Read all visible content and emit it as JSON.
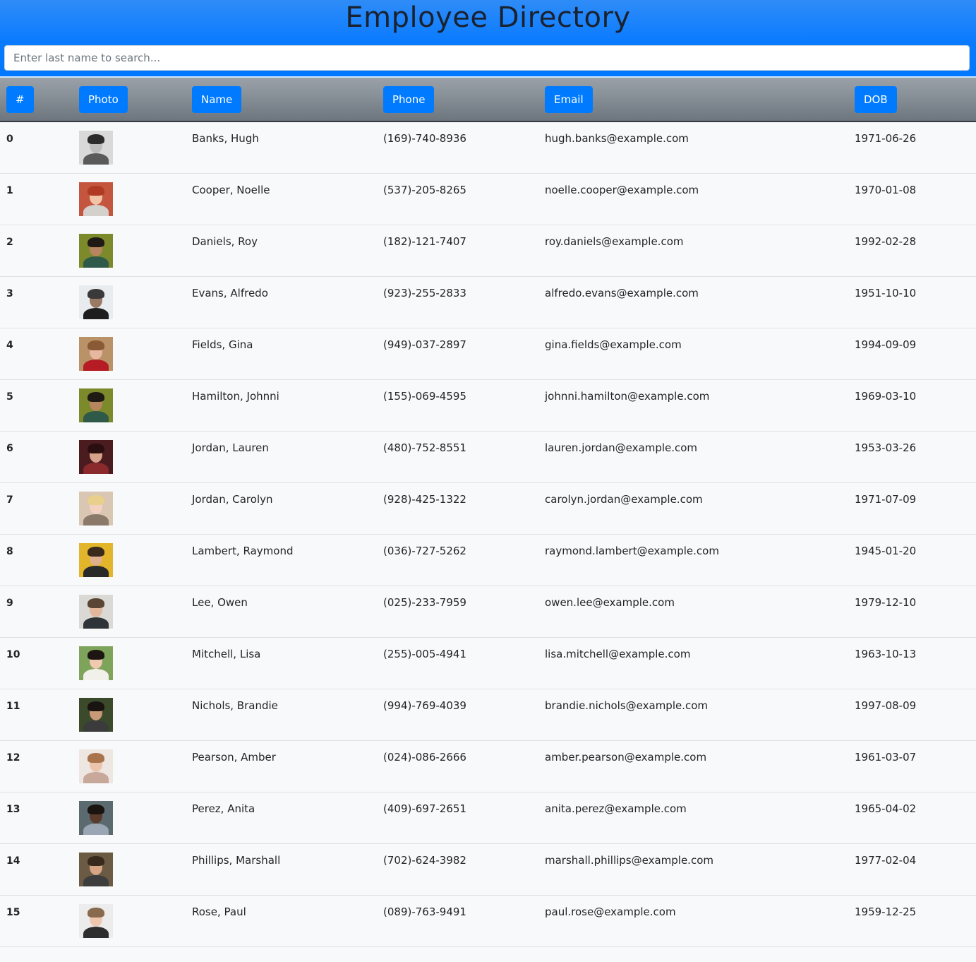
{
  "page": {
    "title": "Employee Directory",
    "search_placeholder": "Enter last name to search..."
  },
  "columns": [
    "#",
    "Photo",
    "Name",
    "Phone",
    "Email",
    "DOB"
  ],
  "employees": [
    {
      "index": "0",
      "name": "Banks, Hugh",
      "phone": "(169)-740-8936",
      "email": "hugh.banks@example.com",
      "dob": "1971-06-26",
      "photo": {
        "bg": "#d9d9d9",
        "face": "#bdbdbd",
        "hair": "#2b2b2b",
        "body": "#5a5a5a"
      }
    },
    {
      "index": "1",
      "name": "Cooper, Noelle",
      "phone": "(537)-205-8265",
      "email": "noelle.cooper@example.com",
      "dob": "1970-01-08",
      "photo": {
        "bg": "#c4563f",
        "face": "#f1c3a7",
        "hair": "#b03a23",
        "body": "#d4d0cc"
      }
    },
    {
      "index": "2",
      "name": "Daniels, Roy",
      "phone": "(182)-121-7407",
      "email": "roy.daniels@example.com",
      "dob": "1992-02-28",
      "photo": {
        "bg": "#7d8a2c",
        "face": "#b78660",
        "hair": "#1f1a14",
        "body": "#2f5a4a"
      }
    },
    {
      "index": "3",
      "name": "Evans, Alfredo",
      "phone": "(923)-255-2833",
      "email": "alfredo.evans@example.com",
      "dob": "1951-10-10",
      "photo": {
        "bg": "#e9ecef",
        "face": "#9a7a64",
        "hair": "#3a3a3a",
        "body": "#1e1e1e"
      }
    },
    {
      "index": "4",
      "name": "Fields, Gina",
      "phone": "(949)-037-2897",
      "email": "gina.fields@example.com",
      "dob": "1994-09-09",
      "photo": {
        "bg": "#b99367",
        "face": "#e7b7a0",
        "hair": "#8a5a37",
        "body": "#b51c24"
      }
    },
    {
      "index": "5",
      "name": "Hamilton, Johnni",
      "phone": "(155)-069-4595",
      "email": "johnni.hamilton@example.com",
      "dob": "1969-03-10",
      "photo": {
        "bg": "#7d8a2c",
        "face": "#b78660",
        "hair": "#1f1a14",
        "body": "#2f5a4a"
      }
    },
    {
      "index": "6",
      "name": "Jordan, Lauren",
      "phone": "(480)-752-8551",
      "email": "lauren.jordan@example.com",
      "dob": "1953-03-26",
      "photo": {
        "bg": "#4a1b1f",
        "face": "#d7a28a",
        "hair": "#2b0f10",
        "body": "#8a2a2c"
      }
    },
    {
      "index": "7",
      "name": "Jordan, Carolyn",
      "phone": "(928)-425-1322",
      "email": "carolyn.jordan@example.com",
      "dob": "1971-07-09",
      "photo": {
        "bg": "#d9c6b3",
        "face": "#f3d1c0",
        "hair": "#e8d08c",
        "body": "#8b7a6a"
      }
    },
    {
      "index": "8",
      "name": "Lambert, Raymond",
      "phone": "(036)-727-5262",
      "email": "raymond.lambert@example.com",
      "dob": "1945-01-20",
      "photo": {
        "bg": "#e3b52b",
        "face": "#e0b08e",
        "hair": "#3a2a1e",
        "body": "#2a2a2a"
      }
    },
    {
      "index": "9",
      "name": "Lee, Owen",
      "phone": "(025)-233-7959",
      "email": "owen.lee@example.com",
      "dob": "1979-12-10",
      "photo": {
        "bg": "#dad9d5",
        "face": "#e3b79b",
        "hair": "#5b4635",
        "body": "#2e3438"
      }
    },
    {
      "index": "10",
      "name": "Mitchell, Lisa",
      "phone": "(255)-005-4941",
      "email": "lisa.mitchell@example.com",
      "dob": "1963-10-13",
      "photo": {
        "bg": "#7ea35a",
        "face": "#efcab0",
        "hair": "#1d1512",
        "body": "#f2f0ea"
      }
    },
    {
      "index": "11",
      "name": "Nichols, Brandie",
      "phone": "(994)-769-4039",
      "email": "brandie.nichols@example.com",
      "dob": "1997-08-09",
      "photo": {
        "bg": "#3c4a2c",
        "face": "#c99a78",
        "hair": "#1a1410",
        "body": "#3b3b3b"
      }
    },
    {
      "index": "12",
      "name": "Pearson, Amber",
      "phone": "(024)-086-2666",
      "email": "amber.pearson@example.com",
      "dob": "1961-03-07",
      "photo": {
        "bg": "#eee6e0",
        "face": "#ecc3ad",
        "hair": "#a9744c",
        "body": "#c7a89b"
      }
    },
    {
      "index": "13",
      "name": "Perez, Anita",
      "phone": "(409)-697-2651",
      "email": "anita.perez@example.com",
      "dob": "1965-04-02",
      "photo": {
        "bg": "#5a6a6f",
        "face": "#5a3a2a",
        "hair": "#1a1410",
        "body": "#9aa6b3"
      }
    },
    {
      "index": "14",
      "name": "Phillips, Marshall",
      "phone": "(702)-624-3982",
      "email": "marshall.phillips@example.com",
      "dob": "1977-02-04",
      "photo": {
        "bg": "#6b5a44",
        "face": "#d7a484",
        "hair": "#3a2a1e",
        "body": "#3d3d3d"
      }
    },
    {
      "index": "15",
      "name": "Rose, Paul",
      "phone": "(089)-763-9491",
      "email": "paul.rose@example.com",
      "dob": "1959-12-25",
      "photo": {
        "bg": "#ececec",
        "face": "#efc7ae",
        "hair": "#8a6a4c",
        "body": "#2e2e2e"
      }
    }
  ]
}
